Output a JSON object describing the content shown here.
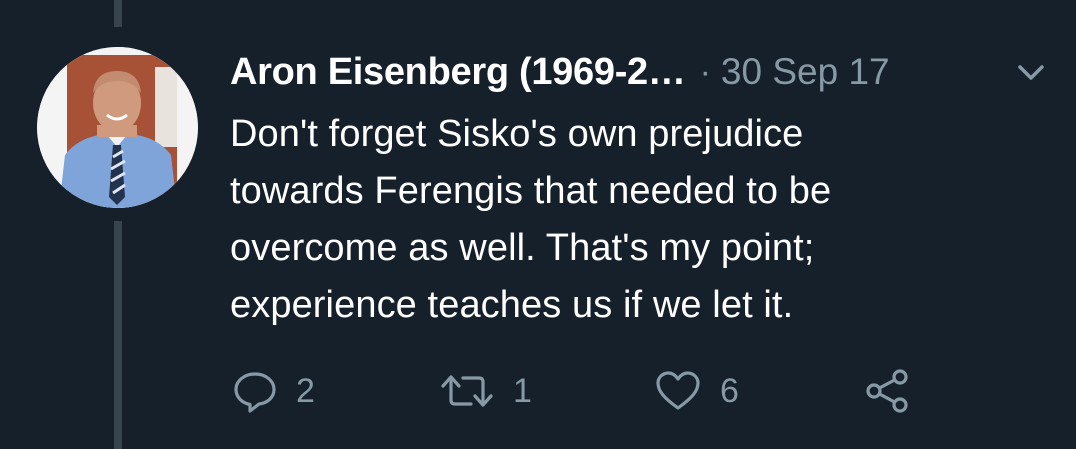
{
  "tweet": {
    "author_name": "Aron Eisenberg (1969-2…",
    "separator": "·",
    "date": "30 Sep 17",
    "text": "Don't forget Sisko's own prejudice\ntowards Ferengis that needed to be\novercome as well. That's my point;\nexperience teaches us if we let it.",
    "avatar_icon": "profile-photo",
    "menu_icon": "chevron-down-icon"
  },
  "actions": {
    "reply": {
      "icon": "reply-icon",
      "count": "2"
    },
    "retweet": {
      "icon": "retweet-icon",
      "count": "1"
    },
    "like": {
      "icon": "heart-icon",
      "count": "6"
    },
    "share": {
      "icon": "share-icon"
    }
  },
  "colors": {
    "background": "#15202b",
    "text_primary": "#ffffff",
    "text_secondary": "#8899a6",
    "thread_line": "#38444d"
  }
}
